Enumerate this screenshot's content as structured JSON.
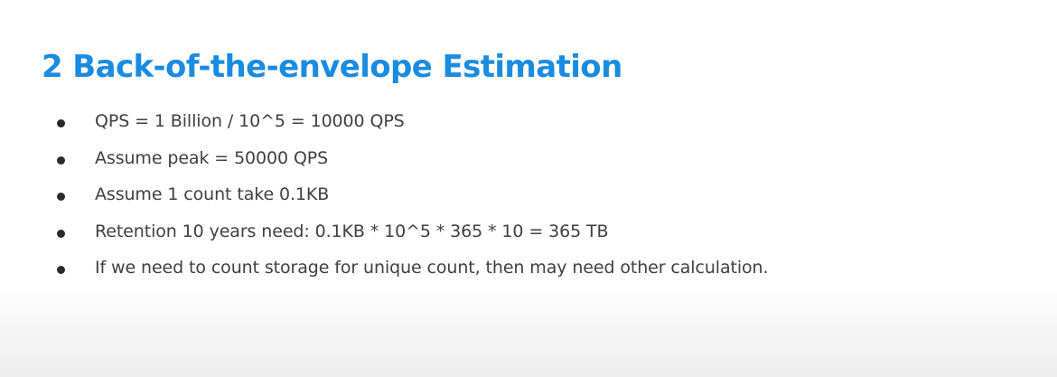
{
  "slide": {
    "title": "2 Back-of-the-envelope Estimation",
    "bullets": [
      "QPS = 1 Billion / 10^5 = 10000 QPS",
      "Assume peak = 50000 QPS",
      "Assume 1 count take 0.1KB",
      "Retention 10 years need: 0.1KB * 10^5 * 365 * 10 = 365 TB",
      "If we need to count storage for unique count, then may need other calculation."
    ]
  },
  "colors": {
    "title": "#1a8ce0",
    "body_text": "#404040",
    "bullet": "#2b2b2b"
  }
}
